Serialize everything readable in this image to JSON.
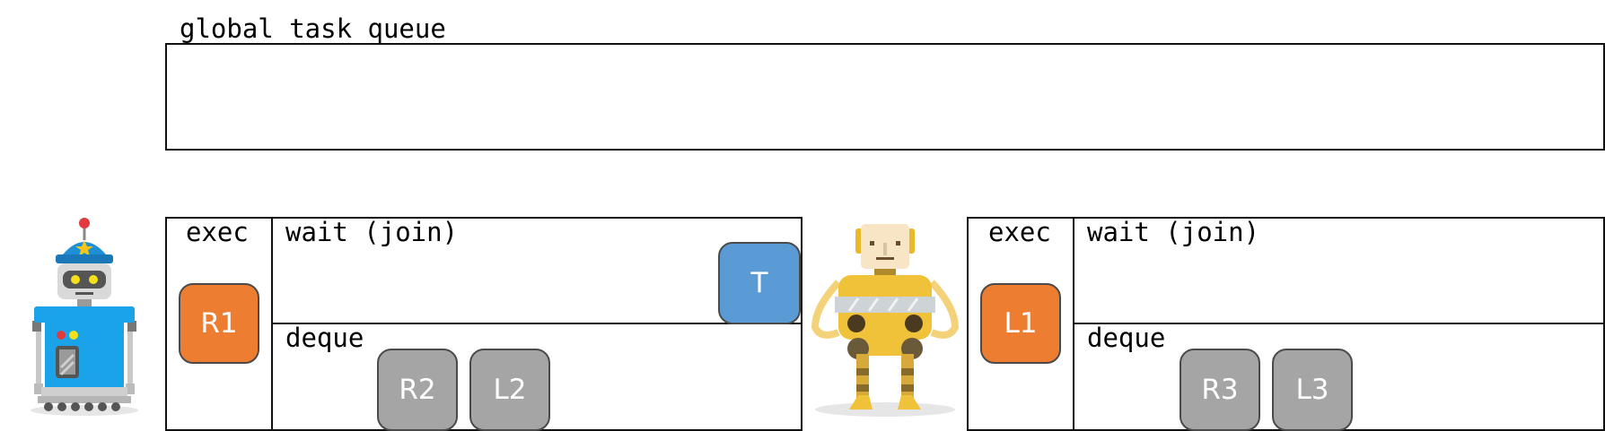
{
  "global_queue": {
    "title": "global task queue"
  },
  "workers": [
    {
      "exec": {
        "label": "exec",
        "task": "R1"
      },
      "wait": {
        "label": "wait (join)",
        "tasks": [
          "T"
        ]
      },
      "deque": {
        "label": "deque",
        "tasks": [
          "R2",
          "L2"
        ]
      },
      "robot_icon": "blue-robot-icon"
    },
    {
      "exec": {
        "label": "exec",
        "task": "L1"
      },
      "wait": {
        "label": "wait (join)",
        "tasks": []
      },
      "deque": {
        "label": "deque",
        "tasks": [
          "R3",
          "L3"
        ]
      },
      "robot_icon": "yellow-robot-icon"
    }
  ],
  "colors": {
    "exec_task": "#ED7D31",
    "wait_task": "#5B9BD5",
    "deque_task": "#A5A5A5",
    "border": "#111111"
  }
}
